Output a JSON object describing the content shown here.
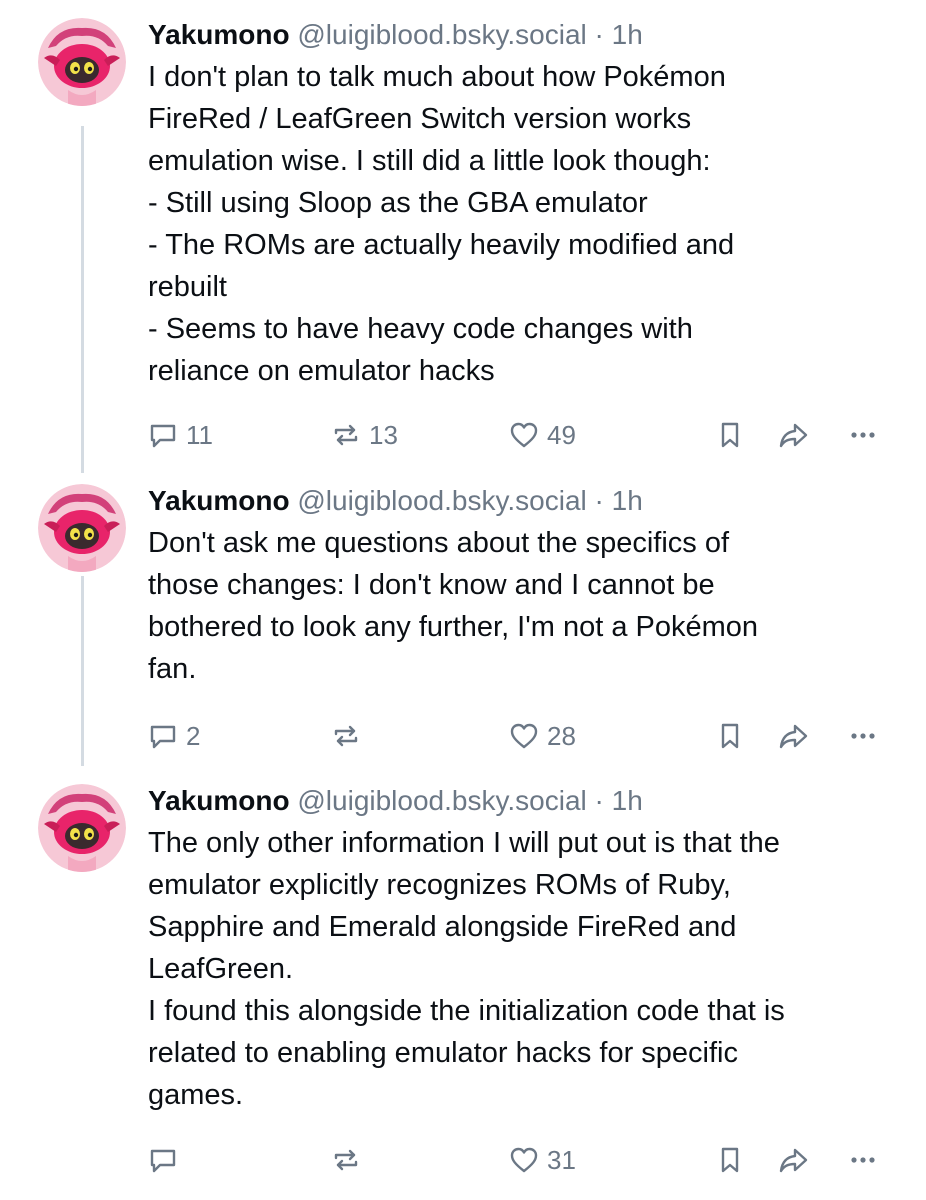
{
  "posts": [
    {
      "author_name": "Yakumono",
      "handle": "@luigiblood.bsky.social",
      "separator": "·",
      "time": "1h",
      "text": "I don't plan to talk much about how Pokémon\nFireRed / LeafGreen Switch version works\nemulation wise. I still did a little look though:\n- Still using Sloop as the GBA emulator\n- The ROMs are actually heavily modified and\nrebuilt\n- Seems to have heavy code changes with\nreliance on emulator hacks",
      "reply_count": "11",
      "repost_count": "13",
      "like_count": "49"
    },
    {
      "author_name": "Yakumono",
      "handle": "@luigiblood.bsky.social",
      "separator": "·",
      "time": "1h",
      "text": "Don't ask me questions about the specifics of\nthose changes: I don't know and I cannot be\nbothered to look any further, I'm not a Pokémon\nfan.",
      "reply_count": "2",
      "repost_count": "",
      "like_count": "28"
    },
    {
      "author_name": "Yakumono",
      "handle": "@luigiblood.bsky.social",
      "separator": "·",
      "time": "1h",
      "text": "The only other information I will put out is that the\nemulator explicitly recognizes ROMs of Ruby,\nSapphire and Emerald alongside FireRed and\nLeafGreen.\nI found this alongside the initialization code that is\nrelated to enabling emulator hacks for specific\ngames.",
      "reply_count": "",
      "repost_count": "",
      "like_count": "31"
    }
  ],
  "icons": {
    "reply": "speech-bubble-icon",
    "repost": "repost-arrows-icon",
    "like": "heart-icon",
    "bookmark": "bookmark-icon",
    "share": "share-arrow-icon",
    "more": "ellipsis-icon"
  },
  "colors": {
    "text": "#0b0f14",
    "muted": "#6b7785",
    "thread_line": "#d4dbe2",
    "avatar_bg": "#f6c8d6"
  }
}
